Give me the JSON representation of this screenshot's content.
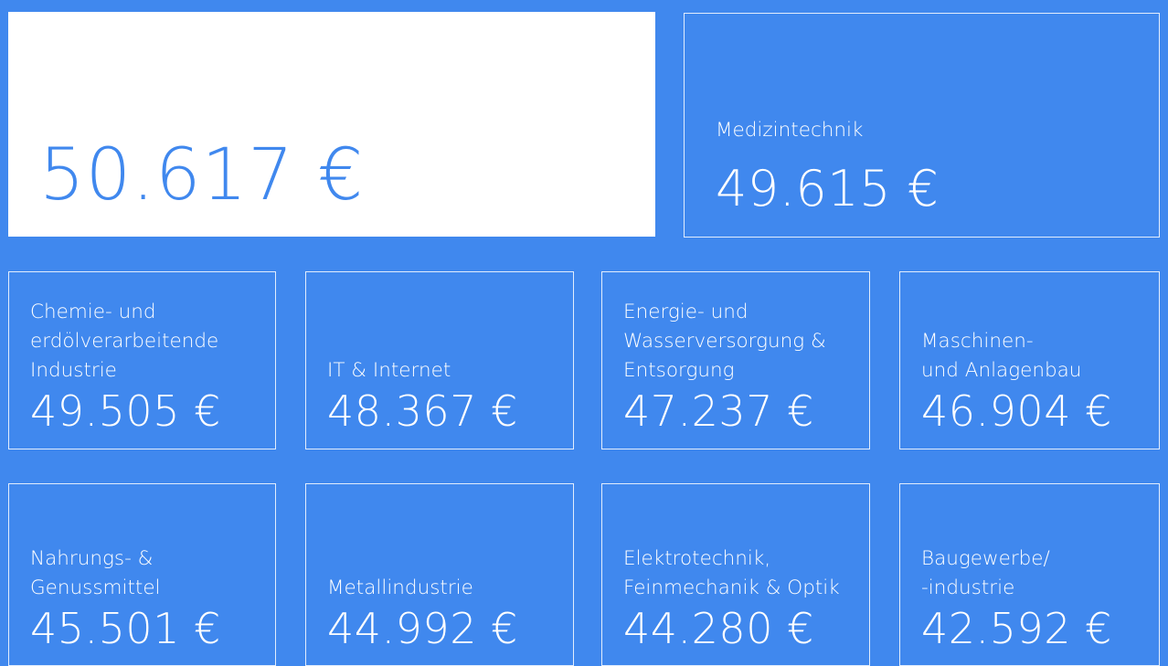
{
  "hero": {
    "value": "50.617 €"
  },
  "tiles_top": [
    {
      "label": "Medizintechnik",
      "value": "49.615 €"
    }
  ],
  "tiles_row1": [
    {
      "label": "Chemie- und\nerdölverarbeitende\nIndustrie",
      "value": "49.505 €"
    },
    {
      "label": "IT & Internet",
      "value": "48.367 €"
    },
    {
      "label": "Energie- und\nWasserversorgung &\nEntsorgung",
      "value": "47.237 €"
    },
    {
      "label": "Maschinen-\nund Anlagenbau",
      "value": "46.904 €"
    }
  ],
  "tiles_row2": [
    {
      "label": "Nahrungs- &\nGenussmittel",
      "value": "45.501 €"
    },
    {
      "label": "Metallindustrie",
      "value": "44.992 €"
    },
    {
      "label": "Elektrotechnik,\nFeinmechanik & Optik",
      "value": "44.280 €"
    },
    {
      "label": "Baugewerbe/\n-industrie",
      "value": "42.592 €"
    }
  ],
  "colors": {
    "background": "#4088ee",
    "hero_background": "#ffffff",
    "text": "#ffffff",
    "hero_text": "#4088ee"
  }
}
